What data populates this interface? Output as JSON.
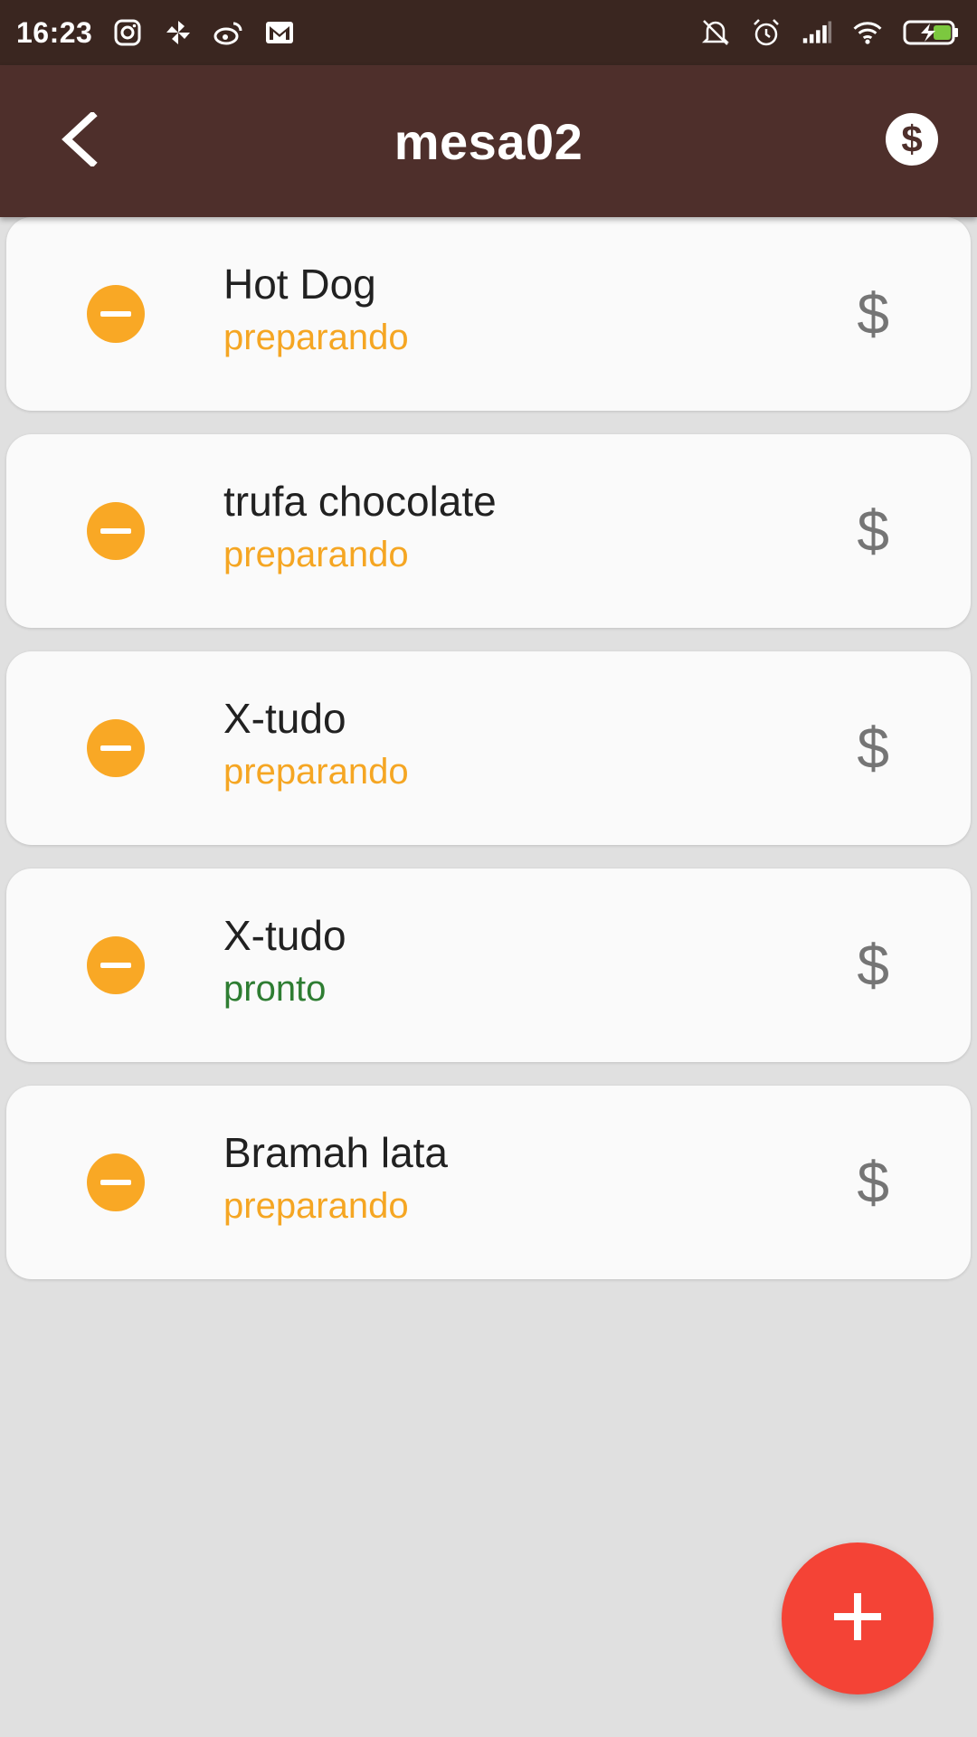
{
  "status_bar": {
    "time": "16:23",
    "left_icons": [
      "instagram-icon",
      "pinwheel-icon",
      "weibo-icon",
      "gmail-icon"
    ],
    "right_icons": [
      "mute-icon",
      "alarm-icon",
      "signal-icon",
      "wifi-icon",
      "battery-charging-icon"
    ]
  },
  "app_bar": {
    "title": "mesa02",
    "back_icon": "chevron-left-icon",
    "action_icon": "dollar-circle-icon"
  },
  "items": [
    {
      "name": "Hot Dog",
      "status": "preparando",
      "status_color": "#f5a623"
    },
    {
      "name": "trufa chocolate",
      "status": "preparando",
      "status_color": "#f5a623"
    },
    {
      "name": "X-tudo",
      "status": "preparando",
      "status_color": "#f5a623"
    },
    {
      "name": "X-tudo",
      "status": "pronto",
      "status_color": "#2e7d32"
    },
    {
      "name": "Bramah lata",
      "status": "preparando",
      "status_color": "#f5a623"
    }
  ],
  "item_action_symbol": "$",
  "fab": {
    "icon": "plus-icon",
    "color": "#f44336"
  },
  "colors": {
    "status_bar": "#3a2620",
    "app_bar": "#4e2f2b",
    "remove_button": "#f9a825",
    "background": "#e0e0e0"
  }
}
